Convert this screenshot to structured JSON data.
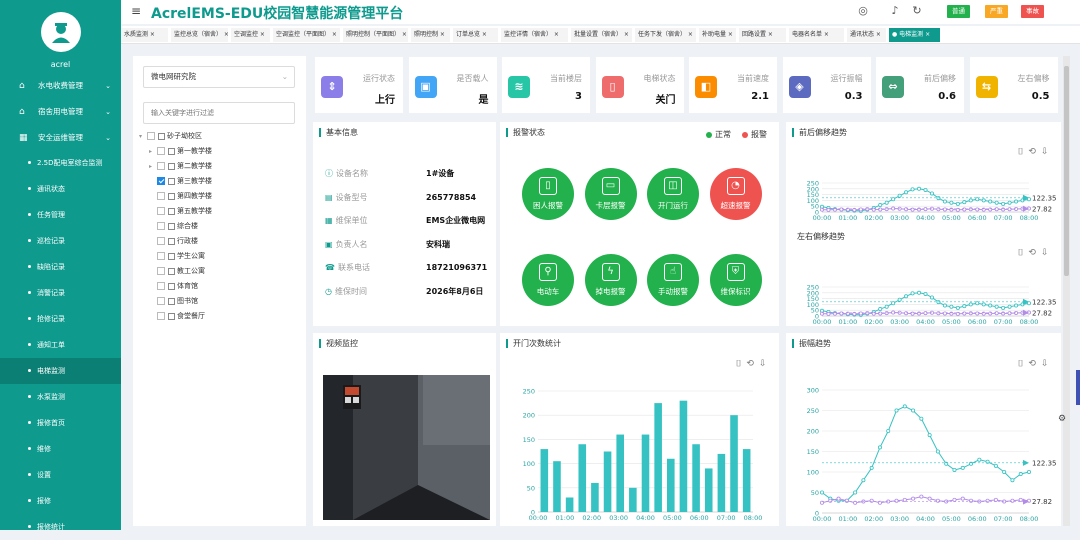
{
  "app": {
    "title": "AcrelEMS-EDU校园智慧能源管理平台",
    "user": "acrel"
  },
  "header_badges": [
    {
      "label": "普通",
      "color": "#22b14c"
    },
    {
      "label": "严重",
      "color": "#f9a825"
    },
    {
      "label": "事故",
      "color": "#ef5350"
    }
  ],
  "sidebar": {
    "groups": [
      {
        "label": "水电收费管理",
        "icon": "house-icon"
      },
      {
        "label": "宿舍用电管理",
        "icon": "home-icon"
      },
      {
        "label": "安全运维管理",
        "icon": "grid-icon"
      }
    ],
    "items": [
      "2.5D配电室综合监测",
      "通讯状态",
      "任务管理",
      "巡检记录",
      "缺陷记录",
      "消警记录",
      "抢修记录",
      "通知工单",
      "电梯监测",
      "水泵监测",
      "报修首页",
      "维修",
      "设置",
      "报修",
      "报修统计"
    ],
    "active": "电梯监测"
  },
  "tabs": [
    "水质监测",
    "监控总览（宿舍）",
    "空调监控",
    "空调监控（平面图）",
    "照明控制（平面图）",
    "照明控制",
    "订单总览",
    "监控详情（宿舍）",
    "批量设置（宿舍）",
    "任务下发（宿舍）",
    "补助电量",
    "回路设置",
    "电器名名单",
    "通讯状态",
    "电梯监测"
  ],
  "tree": {
    "org": "微电网研究院",
    "search_placeholder": "输入关键字进行过滤",
    "root": "砂子坳校区",
    "nodes": [
      {
        "label": "第一教学楼",
        "expandable": true,
        "checked": false
      },
      {
        "label": "第二教学楼",
        "expandable": true,
        "checked": false
      },
      {
        "label": "第三教学楼",
        "expandable": false,
        "checked": true
      },
      {
        "label": "第四教学楼",
        "expandable": false,
        "checked": false
      },
      {
        "label": "第五教学楼",
        "expandable": false,
        "checked": false
      },
      {
        "label": "综合楼",
        "expandable": false,
        "checked": false
      },
      {
        "label": "行政楼",
        "expandable": false,
        "checked": false
      },
      {
        "label": "学生公寓",
        "expandable": false,
        "checked": false
      },
      {
        "label": "教工公寓",
        "expandable": false,
        "checked": false
      },
      {
        "label": "体育馆",
        "expandable": false,
        "checked": false
      },
      {
        "label": "图书馆",
        "expandable": false,
        "checked": false
      },
      {
        "label": "食堂餐厅",
        "expandable": false,
        "checked": false
      }
    ]
  },
  "kpis": [
    {
      "label": "运行状态",
      "value": "上行",
      "color": "#8c7ee8",
      "icon": "elevator-icon"
    },
    {
      "label": "是否载人",
      "value": "是",
      "color": "#42a5f5",
      "icon": "person-icon"
    },
    {
      "label": "当前楼层",
      "value": "3",
      "color": "#26c6a6",
      "icon": "layers-icon"
    },
    {
      "label": "电梯状态",
      "value": "关门",
      "color": "#ef6c6c",
      "icon": "door-icon"
    },
    {
      "label": "当前速度",
      "value": "2.1",
      "color": "#fb8c00",
      "icon": "speed-icon"
    },
    {
      "label": "运行振幅",
      "value": "0.3",
      "color": "#5c6bc0",
      "icon": "vibration-icon"
    },
    {
      "label": "前后偏移",
      "value": "0.6",
      "color": "#43a07a",
      "icon": "offset-icon"
    },
    {
      "label": "左右偏移",
      "value": "0.5",
      "color": "#f0b400",
      "icon": "lateral-offset-icon"
    }
  ],
  "basic_info": {
    "title": "基本信息",
    "rows": [
      {
        "label": "设备名称",
        "value": "1#设备"
      },
      {
        "label": "设备型号",
        "value": "265778854"
      },
      {
        "label": "维保单位",
        "value": "EMS企业微电网"
      },
      {
        "label": "负责人名",
        "value": "安科瑞"
      },
      {
        "label": "联系电话",
        "value": "18721096371"
      },
      {
        "label": "维保时间",
        "value": "2026年8月6日"
      }
    ]
  },
  "alarm": {
    "title": "报警状态",
    "legend_normal": "正常",
    "legend_alarm": "报警",
    "normal_color": "#22b14c",
    "alarm_color": "#ef5350",
    "items": [
      {
        "label": "困人报警",
        "alarm": false
      },
      {
        "label": "卡层报警",
        "alarm": false
      },
      {
        "label": "开门运行",
        "alarm": false
      },
      {
        "label": "超速报警",
        "alarm": true
      },
      {
        "label": "电动车",
        "alarm": false
      },
      {
        "label": "掉电报警",
        "alarm": false
      },
      {
        "label": "手动报警",
        "alarm": false
      },
      {
        "label": "维保标识",
        "alarm": false
      }
    ]
  },
  "video": {
    "title": "视频监控"
  },
  "chart_data": [
    {
      "id": "fb",
      "type": "line",
      "title": "前后偏移趋势",
      "x": [
        "00:00",
        "01:00",
        "02:00",
        "03:00",
        "04:00",
        "05:00",
        "06:00",
        "07:00",
        "08:00"
      ],
      "ylim": [
        0,
        250
      ],
      "yticks": [
        0,
        50,
        100,
        150,
        200,
        250
      ],
      "series": [
        {
          "color": "#36c2c2",
          "values": [
            45,
            35,
            25,
            20,
            15,
            12,
            10,
            20,
            35,
            60,
            80,
            110,
            140,
            170,
            195,
            200,
            190,
            160,
            120,
            90,
            80,
            70,
            85,
            100,
            110,
            100,
            90,
            80,
            70,
            80,
            90,
            100,
            110
          ]
        },
        {
          "color": "#b38ce8",
          "values": [
            20,
            18,
            20,
            22,
            20,
            18,
            22,
            25,
            20,
            22,
            25,
            30,
            28,
            24,
            20,
            22,
            25,
            28,
            24,
            22,
            20,
            18,
            22,
            24,
            22,
            20,
            22,
            24,
            22,
            24,
            26,
            28,
            30
          ]
        }
      ],
      "markers": [
        "122.35",
        "27.82"
      ]
    },
    {
      "id": "lr",
      "type": "line",
      "title": "左右偏移趋势",
      "x": [
        "00:00",
        "01:00",
        "02:00",
        "03:00",
        "04:00",
        "05:00",
        "06:00",
        "07:00",
        "08:00"
      ],
      "ylim": [
        0,
        250
      ],
      "yticks": [
        0,
        50,
        100,
        150,
        200,
        250
      ],
      "series": [
        {
          "color": "#36c2c2",
          "values": [
            45,
            35,
            25,
            20,
            15,
            12,
            10,
            20,
            35,
            60,
            80,
            110,
            140,
            170,
            195,
            200,
            190,
            160,
            120,
            90,
            80,
            70,
            85,
            100,
            110,
            100,
            90,
            80,
            70,
            80,
            90,
            100,
            110
          ]
        },
        {
          "color": "#b38ce8",
          "values": [
            20,
            18,
            20,
            22,
            20,
            18,
            22,
            25,
            20,
            22,
            25,
            30,
            28,
            24,
            20,
            22,
            25,
            28,
            24,
            22,
            20,
            18,
            22,
            24,
            22,
            20,
            22,
            24,
            22,
            24,
            26,
            28,
            30
          ]
        }
      ],
      "markers": [
        "122.35",
        "27.82"
      ]
    },
    {
      "id": "door",
      "type": "bar",
      "title": "开门次数统计",
      "x": [
        "00:00",
        "01:00",
        "02:00",
        "03:00",
        "04:00",
        "05:00",
        "06:00",
        "07:00",
        "08:00"
      ],
      "ylim": [
        0,
        250
      ],
      "yticks": [
        0,
        50,
        100,
        150,
        200,
        250
      ],
      "color": "#36c2c2",
      "values": [
        130,
        105,
        30,
        140,
        60,
        125,
        160,
        50,
        160,
        225,
        110,
        230,
        140,
        90,
        120,
        200,
        130
      ]
    },
    {
      "id": "vib",
      "type": "line",
      "title": "振幅趋势",
      "x": [
        "00:00",
        "01:00",
        "02:00",
        "03:00",
        "04:00",
        "05:00",
        "06:00",
        "07:00",
        "08:00"
      ],
      "ylim": [
        0,
        300
      ],
      "yticks": [
        0,
        50,
        100,
        150,
        200,
        250,
        300
      ],
      "series": [
        {
          "color": "#36c2c2",
          "values": [
            50,
            35,
            30,
            30,
            50,
            80,
            110,
            160,
            200,
            250,
            260,
            250,
            230,
            190,
            150,
            120,
            105,
            110,
            120,
            130,
            125,
            115,
            100,
            80,
            95,
            100
          ]
        },
        {
          "color": "#b38ce8",
          "values": [
            25,
            30,
            35,
            30,
            25,
            28,
            30,
            25,
            28,
            30,
            32,
            35,
            40,
            35,
            30,
            28,
            32,
            35,
            30,
            28,
            30,
            32,
            28,
            30,
            32,
            30
          ]
        }
      ],
      "markers": [
        "122.35",
        "27.82"
      ]
    }
  ]
}
